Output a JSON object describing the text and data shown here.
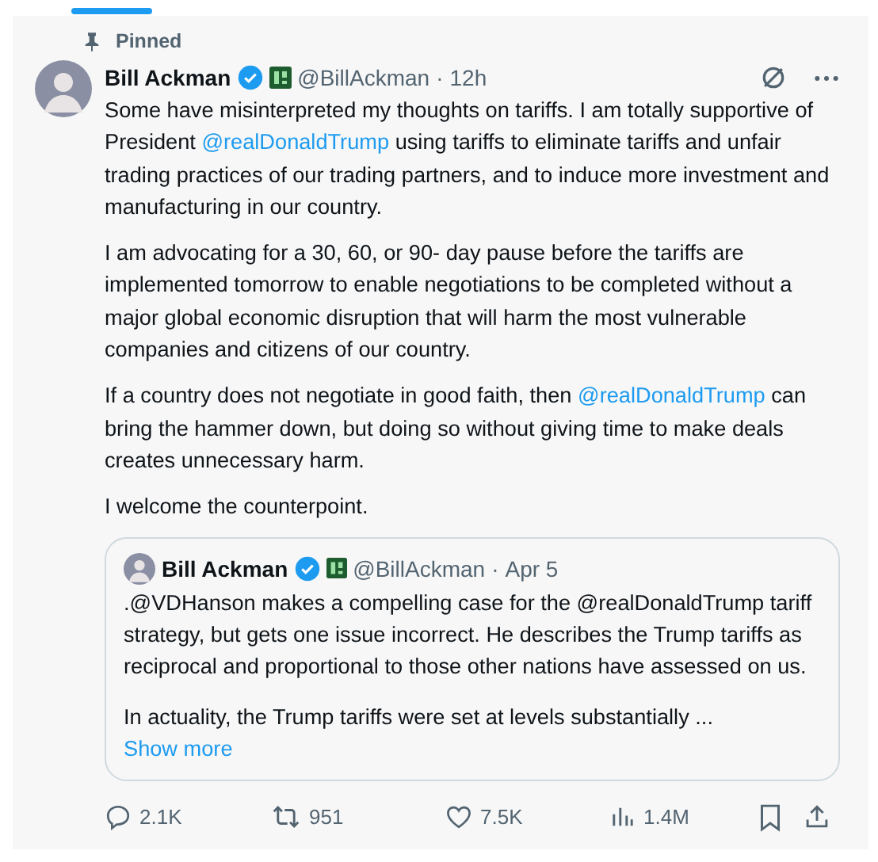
{
  "pinned": {
    "label": "Pinned"
  },
  "tweet": {
    "name": "Bill Ackman",
    "verified": true,
    "handle": "@BillAckman",
    "separator": "·",
    "time": "12h",
    "paragraphs": [
      [
        {
          "kind": "text",
          "text": "Some have misinterpreted my thoughts on tariffs. I am totally supportive of President "
        },
        {
          "kind": "mention",
          "text": "@realDonaldTrump"
        },
        {
          "kind": "text",
          "text": " using tariffs to eliminate tariffs and unfair trading practices of our trading partners, and to induce more investment and manufacturing in our country."
        }
      ],
      [
        {
          "kind": "text",
          "text": "I am advocating for a 30, 60, or 90- day pause before the tariffs are implemented tomorrow to enable negotiations to be completed without a major global economic disruption that will harm the most vulnerable companies and citizens of our country."
        }
      ],
      [
        {
          "kind": "text",
          "text": "If a country does not negotiate in good faith, then "
        },
        {
          "kind": "mention",
          "text": "@realDonaldTrump"
        },
        {
          "kind": "text",
          "text": " can bring the hammer down, but doing so without giving time to make deals creates unnecessary harm."
        }
      ],
      [
        {
          "kind": "text",
          "text": "I welcome the counterpoint."
        }
      ]
    ],
    "quote": {
      "name": "Bill Ackman",
      "verified": true,
      "handle": "@BillAckman",
      "separator": "·",
      "time": "Apr 5",
      "paragraphs": [
        ".@VDHanson makes a compelling case for the @realDonaldTrump tariff strategy, but gets one issue incorrect. He describes the Trump tariffs as reciprocal and proportional to those other nations have assessed on us.",
        "In actuality, the Trump tariffs were set at levels substantially ..."
      ],
      "show_more": "Show more"
    },
    "actions": [
      {
        "kind": "reply",
        "count": "2.1K"
      },
      {
        "kind": "repost",
        "count": "951"
      },
      {
        "kind": "like",
        "count": "7.5K"
      },
      {
        "kind": "views",
        "count": "1.4M"
      }
    ]
  }
}
